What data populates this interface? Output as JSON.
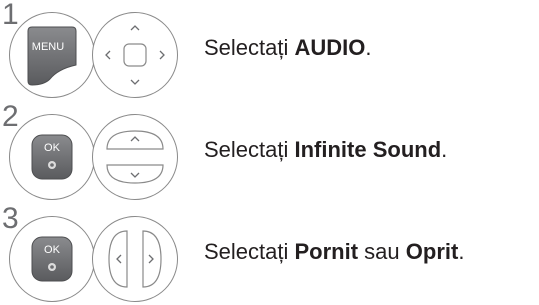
{
  "steps": [
    {
      "number": "1",
      "button_label": "MENU",
      "text_prefix": "Selectați ",
      "text_bold": "AUDIO",
      "text_suffix": "."
    },
    {
      "number": "2",
      "button_label": "OK",
      "text_prefix": "Selectați ",
      "text_bold": "Infinite Sound",
      "text_suffix": "."
    },
    {
      "number": "3",
      "button_label": "OK",
      "text_prefix": "Selectați ",
      "text_bold": "Pornit",
      "text_middle": " sau ",
      "text_bold_2": "Oprit",
      "text_suffix": "."
    }
  ],
  "colors": {
    "button_fill": "#6d6e71",
    "outline": "#8a8a8a",
    "text": "#231f20"
  },
  "icons": [
    "menu-button-icon",
    "navigation-pad-icon",
    "ok-button-icon",
    "up-down-buttons-icon",
    "left-right-buttons-icon"
  ]
}
